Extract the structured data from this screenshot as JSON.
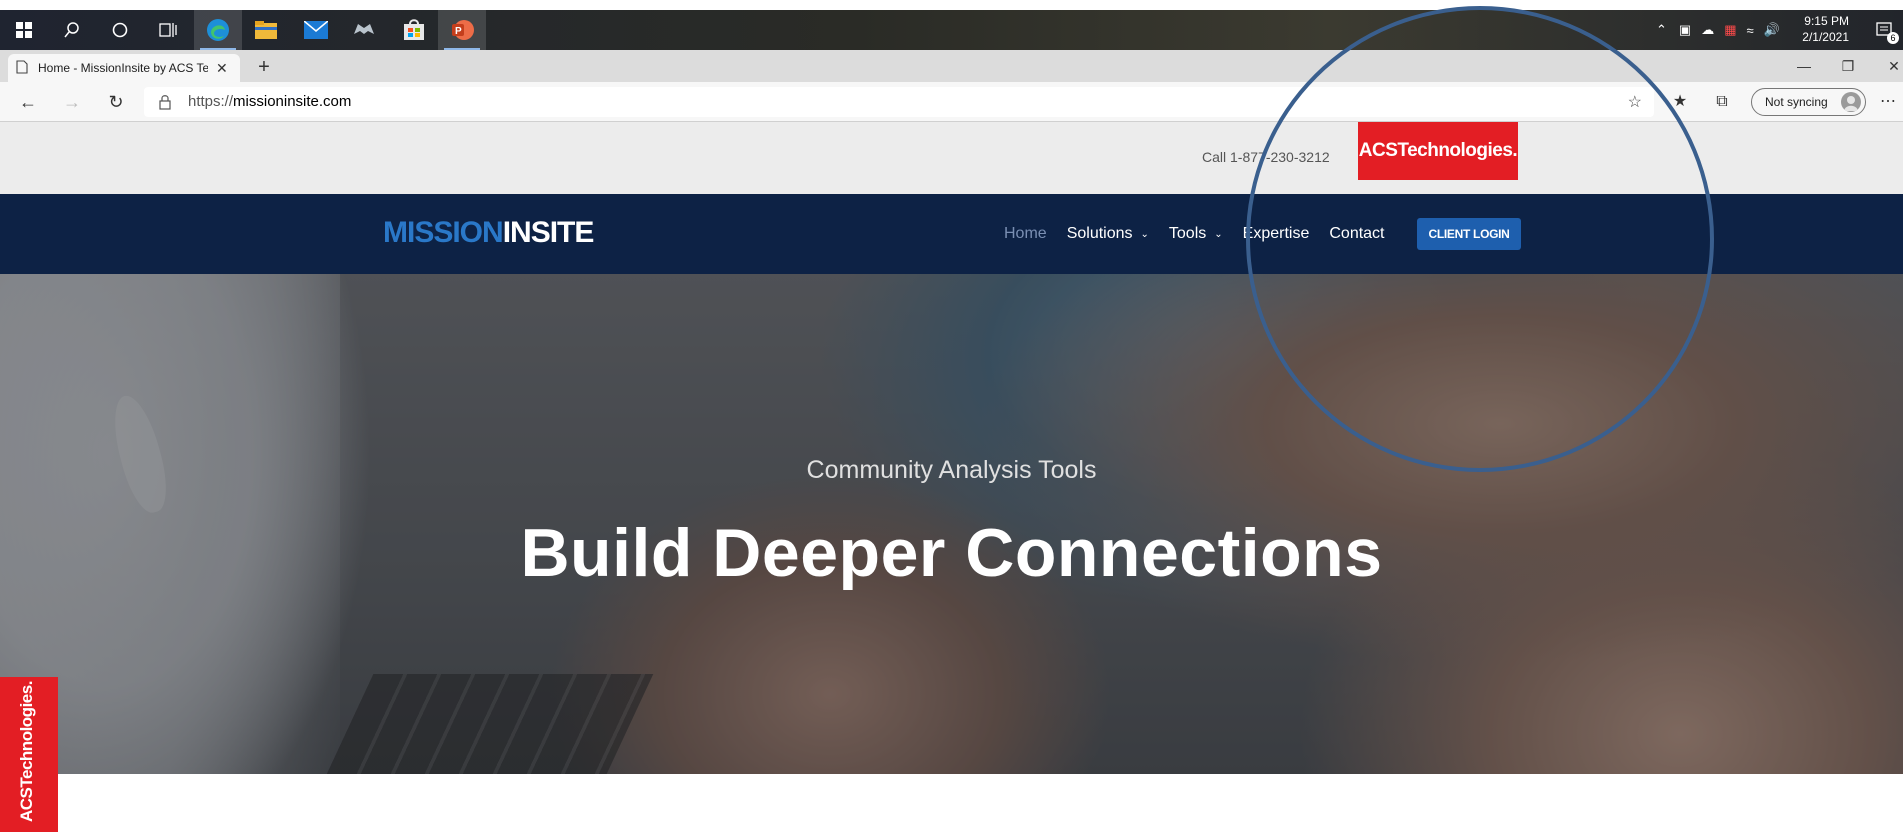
{
  "taskbar": {
    "icons": [
      "windows-start-icon",
      "search-icon",
      "cortana-icon",
      "task-view-icon",
      "edge-icon",
      "file-explorer-icon",
      "mail-icon",
      "xbox-icon",
      "store-icon",
      "powerpoint-icon"
    ],
    "clock_time": "9:15 PM",
    "clock_date": "2/1/2021",
    "notification_count": "6"
  },
  "browser": {
    "tab_title": "Home - MissionInsite by ACS Tec",
    "url_scheme": "https://",
    "url_host": "missioninsite.com",
    "sync_label": "Not syncing"
  },
  "site": {
    "phone": "Call 1-877-230-3212",
    "acs_logo_text": "ACSTechnologies.",
    "brand_part1": "MISSION",
    "brand_part2": "INSITE",
    "nav": {
      "home": "Home",
      "solutions": "Solutions",
      "tools": "Tools",
      "expertise": "Expertise",
      "contact": "Contact",
      "client_login": "CLIENT LOGIN"
    },
    "hero_subtitle": "Community Analysis Tools",
    "hero_title": "Build Deeper Connections",
    "side_tab_text": "ACSTechnologies."
  },
  "colors": {
    "nav_bg": "#0d2245",
    "acs_red": "#e31e24",
    "login_blue": "#1e5fae",
    "annotation_circle": "#3a5f8e"
  }
}
